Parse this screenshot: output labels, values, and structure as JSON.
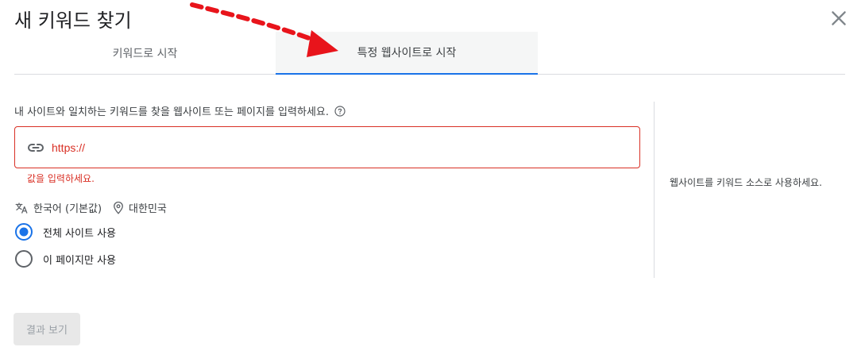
{
  "dialog": {
    "title": "새 키워드 찾기"
  },
  "tabs": [
    {
      "label": "키워드로 시작",
      "selected": false
    },
    {
      "label": "특정 웹사이트로 시작",
      "selected": true
    }
  ],
  "form": {
    "instruction": "내 사이트와 일치하는 키워드를 찾을 웹사이트 또는 페이지를 입력하세요.",
    "url_prefix": "https://",
    "url_value": "",
    "error": "값을 입력하세요.",
    "language": "한국어 (기본값)",
    "location": "대한민국",
    "scope_options": [
      {
        "label": "전체 사이트 사용",
        "selected": true
      },
      {
        "label": "이 페이지만 사용",
        "selected": false
      }
    ]
  },
  "side_note": "웹사이트를 키워드 소스로 사용하세요.",
  "actions": {
    "results_label": "결과 보기",
    "results_enabled": false
  },
  "colors": {
    "accent": "#1a73e8",
    "error": "#d93025",
    "annotation_arrow": "#e8141b",
    "divider": "#dadce0"
  },
  "icons": {
    "close": "close-icon",
    "help": "help-icon",
    "link": "link-icon",
    "translate": "translate-icon",
    "location": "location-pin-icon"
  }
}
